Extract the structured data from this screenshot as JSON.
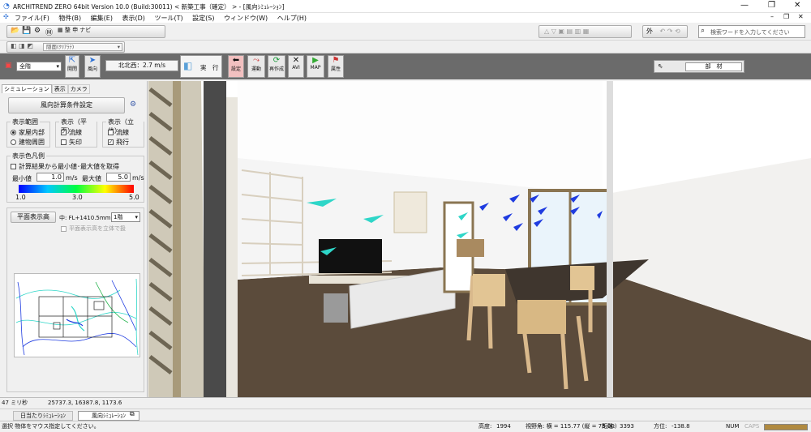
{
  "window": {
    "title": "ARCHITREND ZERO 64bit Version 10.0 (Build:30011) <         新築工事（確定） > - [風向ｼﾐｭﾚｰｼｮﾝ]"
  },
  "menu": [
    "ファイル(F)",
    "物件(B)",
    "編集(E)",
    "表示(D)",
    "ツール(T)",
    "設定(S)",
    "ウィンドウ(W)",
    "ヘルプ(H)"
  ],
  "toolbar1": {
    "display_select": "隠面(ｸﾘｱﾗﾃ)",
    "outer_label": "外",
    "search_placeholder": "検索ワードを入力してください"
  },
  "toolbar2": {
    "floor_select": "全階",
    "btn_toggle": "開閉",
    "btn_wind": "風向",
    "wind_readout": "北北西：2.7 m/s",
    "btn_run": "実　行",
    "tools": [
      "設定",
      "運動",
      "再作成",
      "AVI",
      "MAP",
      "属性"
    ],
    "material_label": "部　材"
  },
  "panel": {
    "tabs": [
      "シミュレーション",
      "表示",
      "カメラ"
    ],
    "main_button": "風向計算条件設定",
    "range": {
      "title": "表示範囲",
      "opt1": "家屋内部",
      "opt2": "建物周囲"
    },
    "plane": {
      "title": "表示（平面）",
      "opt1": "流線",
      "opt2": "矢印"
    },
    "solid": {
      "title": "表示（立体）",
      "opt1": "流線",
      "opt2": "飛行"
    },
    "legend": {
      "title": "表示色凡例",
      "auto_label": "計算結果から最小値･最大値を取得",
      "min_label": "最小値",
      "min_value": "1.0",
      "max_label": "最大値",
      "max_value": "5.0",
      "unit": "m/s",
      "ticks": [
        "1.0",
        "3.0",
        "5.0"
      ]
    },
    "plan_btn": "平面表示高",
    "height_text": "中: FL+1410.5mm",
    "floor_value": "1階",
    "solid_height": "平面表示高を立体で扱"
  },
  "status": {
    "left_top": "47 ミリ秒",
    "coords": "25737.3, 16387.8, 1173.6",
    "tab1": "日当たりｼﾐｭﾚｰｼｮﾝ",
    "tab2": "風向ｼﾐｭﾚｰｼｮﾝ",
    "message": "選択 物体をマウス指定してください。",
    "height_label": "高度:",
    "height_value": "1994",
    "fov": "視野角: 横 = 115.77 (縦 = 75.00)",
    "dist_label": "距離:",
    "dist_value": "3393",
    "dir_label": "方位:",
    "dir_value": "-138.8",
    "num": "NUM",
    "caps": "CAPS"
  },
  "colors": {
    "accent": "#2a6fd6",
    "stream_cyan": "#2ed6c8",
    "stream_blue": "#1f3ce0",
    "legend_stops": [
      "#0000ff",
      "#00c8ff",
      "#00ff40",
      "#ffff00",
      "#ff0000"
    ]
  }
}
